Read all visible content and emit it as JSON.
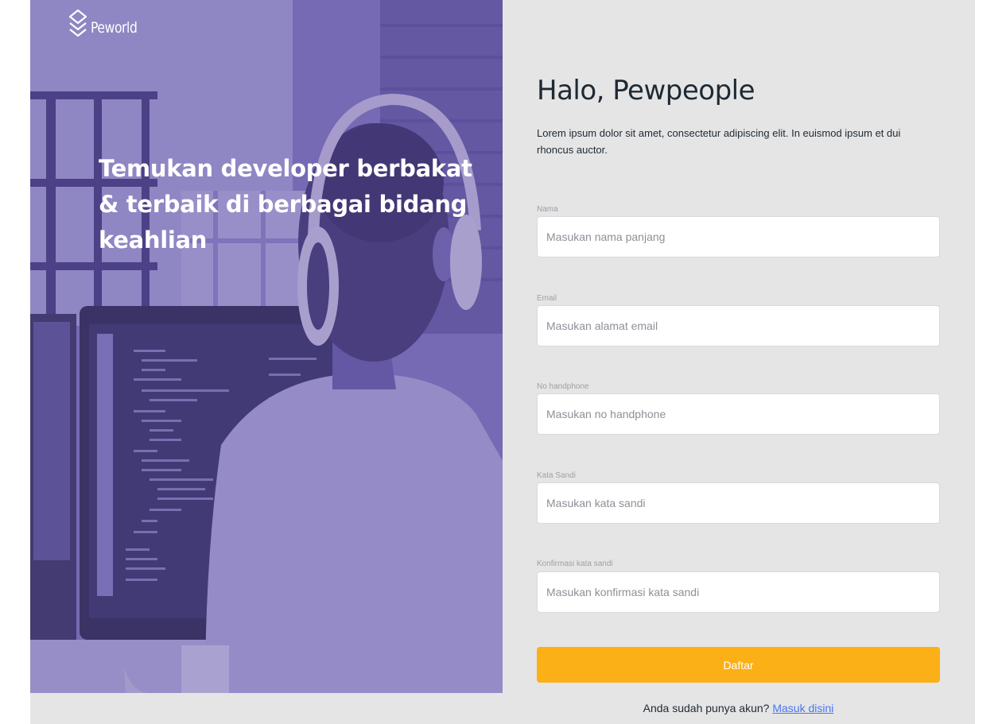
{
  "brand": {
    "name": "Peworld",
    "logo_icon": "stacked-chevrons-icon"
  },
  "hero": {
    "title": "Temukan developer berbakat & terbaik di berbagai bidang keahlian",
    "image": "developer-with-headphones-photo",
    "overlay_color": "#5e50a1"
  },
  "form": {
    "greeting": "Halo, Pewpeople",
    "intro": "Lorem ipsum dolor sit amet, consectetur adipiscing elit. In euismod ipsum et dui rhoncus auctor.",
    "fields": [
      {
        "label": "Nama",
        "placeholder": "Masukan nama panjang",
        "value": ""
      },
      {
        "label": "Email",
        "placeholder": "Masukan alamat email",
        "value": ""
      },
      {
        "label": "No handphone",
        "placeholder": "Masukan no handphone",
        "value": ""
      },
      {
        "label": "Kata Sandi",
        "placeholder": "Masukan kata sandi",
        "value": ""
      },
      {
        "label": "Konfirmasi kata sandi",
        "placeholder": "Masukan konfirmasi kata sandi",
        "value": ""
      }
    ],
    "submit_label": "Daftar",
    "submit_color": "#fbb017",
    "login_prompt": "Anda sudah punya akun?",
    "login_link": "Masuk disini",
    "link_color": "#4676f2"
  }
}
